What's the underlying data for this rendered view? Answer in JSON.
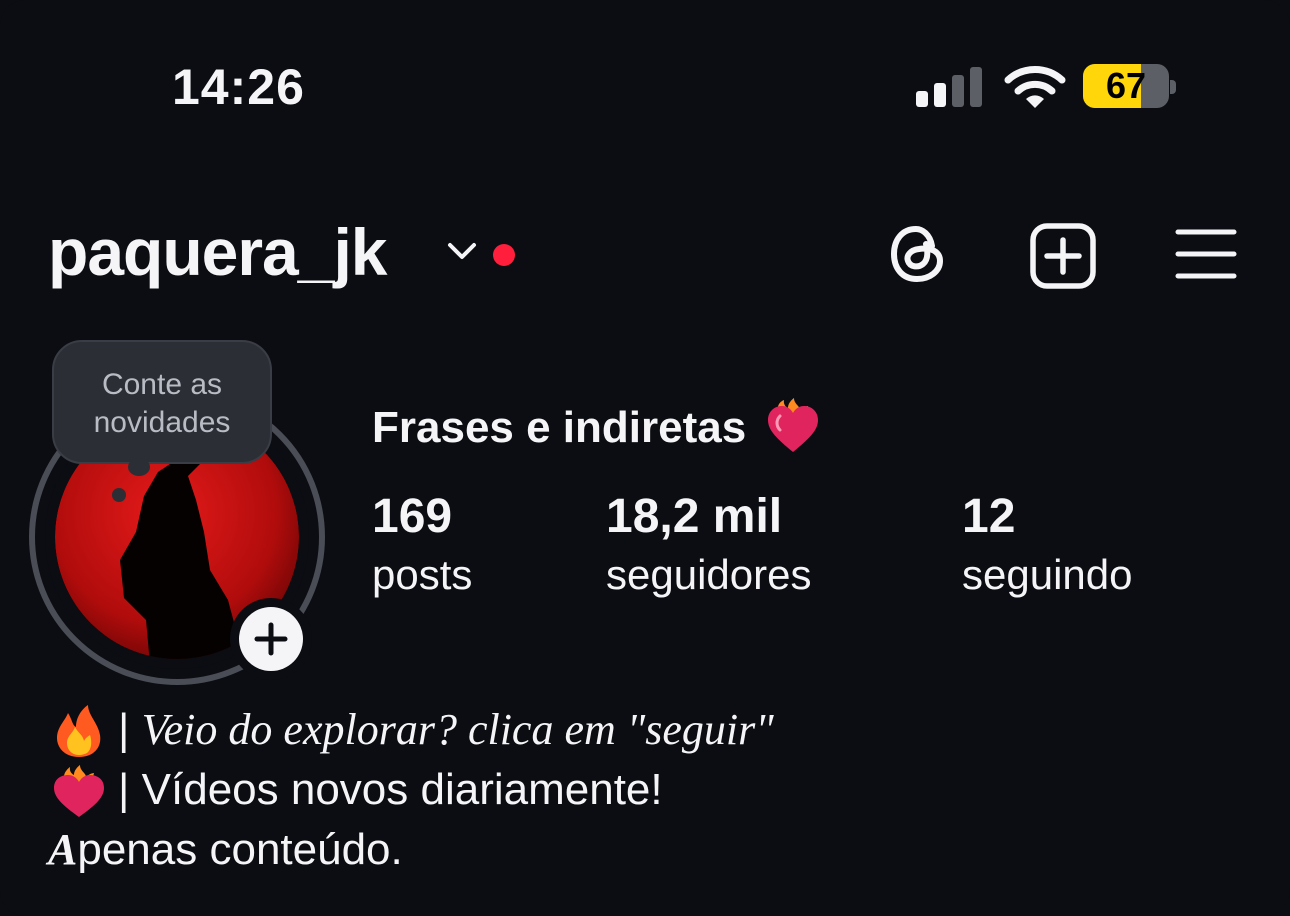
{
  "status_bar": {
    "time": "14:26",
    "battery_level": 67,
    "battery_text": "67",
    "signal_bars_active": 2,
    "signal_bars_total": 4
  },
  "header": {
    "username": "paquera_jk",
    "icons": [
      "chevron-down-icon",
      "threads-icon",
      "new-post-icon",
      "menu-icon"
    ],
    "notification_dot_color": "#ff1f3d"
  },
  "avatar": {
    "note_tooltip": [
      "Conte as",
      "novidades"
    ]
  },
  "profile": {
    "display_name": "Frases e indiretas",
    "stats": [
      {
        "count": "169",
        "label": "posts"
      },
      {
        "count": "18,2 mil",
        "label": "seguidores"
      },
      {
        "count": "12",
        "label": "seguindo"
      }
    ]
  },
  "bio": {
    "line1_sep": "| ",
    "line1_text": "Veio do explorar? clica em \"seguir\"",
    "line2_text": "| Vídeos novos diariamente!",
    "line3_first": "A",
    "line3_rest": "penas conteúdo."
  },
  "colors": {
    "background": "#0b0d12",
    "text": "#f5f5f7",
    "battery": "#ffd60a",
    "accent_red": "#ff1f3d"
  }
}
